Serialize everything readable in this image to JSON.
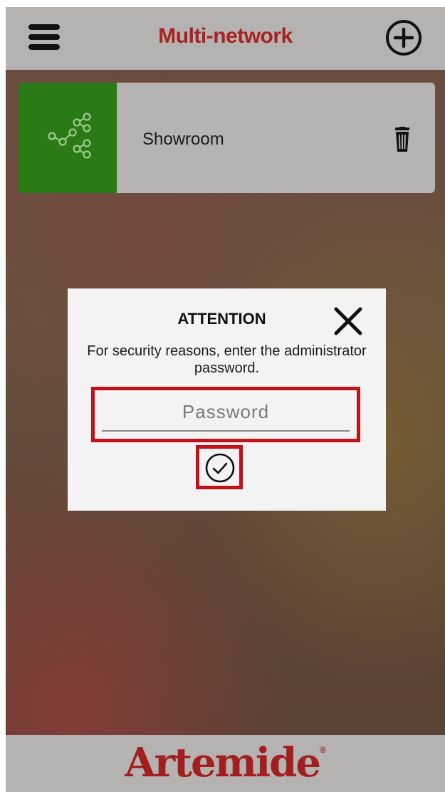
{
  "header": {
    "title": "Multi-network",
    "menu_icon": "hamburger-menu-icon",
    "add_icon": "plus-circle-icon"
  },
  "networks": [
    {
      "name": "Showroom",
      "icon": "share-network-icon",
      "icon_bg": "#2a7a16",
      "delete_icon": "trash-icon"
    }
  ],
  "dialog": {
    "title": "ATTENTION",
    "message": "For security reasons, enter the administrator password.",
    "password_placeholder": "Password",
    "password_value": "",
    "close_icon": "close-icon",
    "confirm_icon": "check-circle-icon",
    "highlight_color": "#c1121a"
  },
  "footer": {
    "brand": "Artemide",
    "registered_mark": "®",
    "brand_color": "#a31f1f"
  },
  "colors": {
    "title_red": "#a82323",
    "header_gray": "#b4b3b2"
  }
}
